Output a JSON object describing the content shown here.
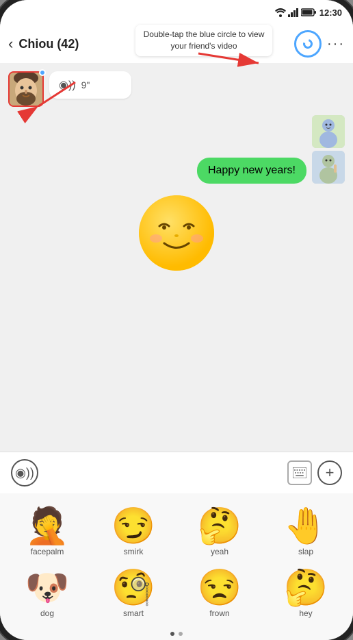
{
  "status_bar": {
    "time": "12:30"
  },
  "tooltip": {
    "text": "Double-tap the blue circle to view your friend's video"
  },
  "header": {
    "back_label": "‹",
    "title": "Chiou (42)",
    "more_label": "···"
  },
  "chat": {
    "voice_duration": "9\"",
    "text_message": "Happy new years!",
    "emoji_message": "😏"
  },
  "input": {
    "mic_icon": "◉",
    "keyboard_icon": "⌨",
    "plus_icon": "+"
  },
  "emoji_picker": {
    "items": [
      {
        "emoji": "🤦",
        "label": "facepalm"
      },
      {
        "emoji": "😏",
        "label": "smirk"
      },
      {
        "emoji": "🤔",
        "label": "yeah"
      },
      {
        "emoji": "👋",
        "label": "slap"
      },
      {
        "emoji": "🐕",
        "label": "dog"
      },
      {
        "emoji": "🤨",
        "label": "smart"
      },
      {
        "emoji": "😒",
        "label": "frown"
      },
      {
        "emoji": "🤔",
        "label": "hey"
      }
    ]
  },
  "dots": {
    "active": 0,
    "total": 2
  }
}
